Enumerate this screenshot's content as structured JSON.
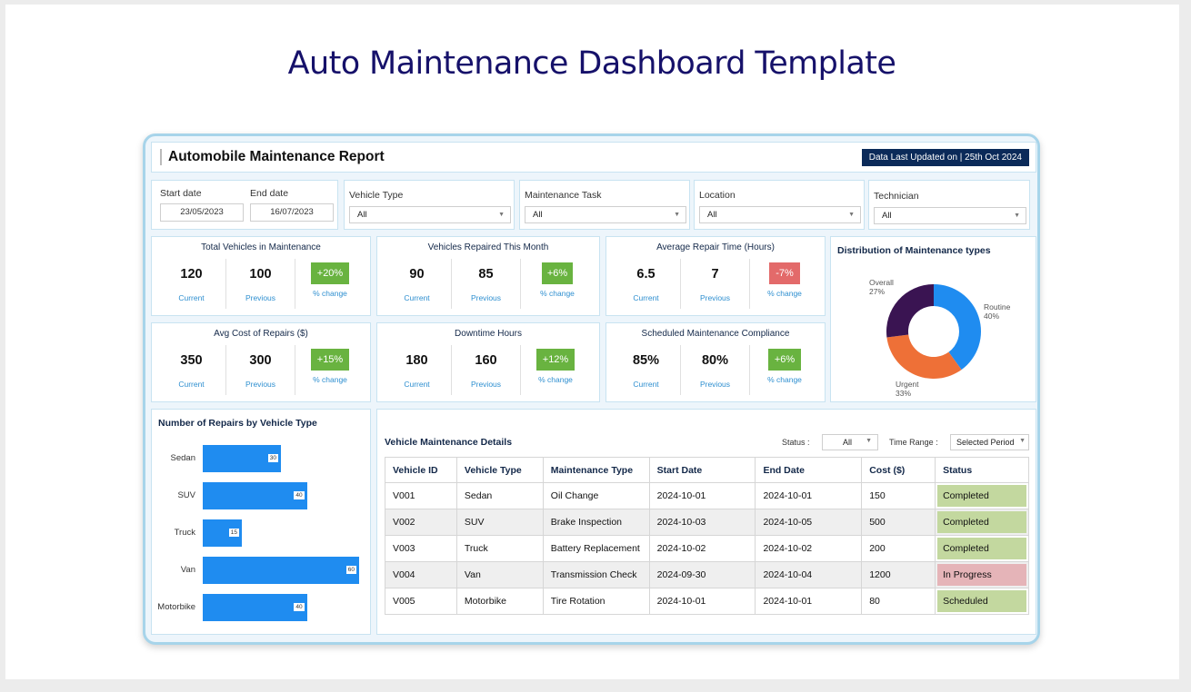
{
  "page_title": "Auto Maintenance Dashboard Template",
  "report": {
    "title": "Automobile Maintenance Report",
    "updated": "Data Last Updated on | 25th Oct 2024"
  },
  "filters": {
    "start_date_label": "Start date",
    "start_date": "23/05/2023",
    "end_date_label": "End date",
    "end_date": "16/07/2023",
    "vehicle_type_label": "Vehicle Type",
    "vehicle_type": "All",
    "maintenance_task_label": "Maintenance Task",
    "maintenance_task": "All",
    "location_label": "Location",
    "location": "All",
    "technician_label": "Technician",
    "technician": "All"
  },
  "kpis": [
    {
      "title": "Total Vehicles in Maintenance",
      "current": "120",
      "previous": "100",
      "change": "+20%",
      "positive": true
    },
    {
      "title": "Vehicles Repaired This Month",
      "current": "90",
      "previous": "85",
      "change": "+6%",
      "positive": true
    },
    {
      "title": "Average Repair Time (Hours)",
      "current": "6.5",
      "previous": "7",
      "change": "-7%",
      "positive": false
    },
    {
      "title": "Avg Cost of Repairs ($)",
      "current": "350",
      "previous": "300",
      "change": "+15%",
      "positive": true
    },
    {
      "title": "Downtime Hours",
      "current": "180",
      "previous": "160",
      "change": "+12%",
      "positive": true
    },
    {
      "title": "Scheduled Maintenance Compliance",
      "current": "85%",
      "previous": "80%",
      "change": "+6%",
      "positive": true
    }
  ],
  "kpi_labels": {
    "current": "Current",
    "previous": "Previous",
    "change": "% change"
  },
  "donut": {
    "title": "Distribution of Maintenance types",
    "slices": [
      {
        "name": "Routine",
        "pct": "40%",
        "value": 40,
        "color": "#1f8cf0"
      },
      {
        "name": "Urgent",
        "pct": "33%",
        "value": 33,
        "color": "#ee7037"
      },
      {
        "name": "Overall",
        "pct": "27%",
        "value": 27,
        "color": "#3a1452"
      }
    ]
  },
  "chart_data": {
    "type": "bar",
    "title": "Number of Repairs by Vehicle Type",
    "categories": [
      "Sedan",
      "SUV",
      "Truck",
      "Van",
      "Motorbike"
    ],
    "values": [
      30,
      40,
      15,
      60,
      40
    ],
    "xlim": [
      0,
      60
    ],
    "color": "#1f8cf0",
    "orientation": "horizontal"
  },
  "table": {
    "title": "Vehicle Maintenance Details",
    "status_label": "Status :",
    "status_value": "All",
    "time_label": "Time Range :",
    "time_value": "Selected Period",
    "columns": [
      "Vehicle ID",
      "Vehicle Type",
      "Maintenance Type",
      "Start Date",
      "End Date",
      "Cost ($)",
      "Status"
    ],
    "rows": [
      {
        "id": "V001",
        "type": "Sedan",
        "mtype": "Oil Change",
        "start": "2024-10-01",
        "end": "2024-10-01",
        "cost": "150",
        "status": "Completed"
      },
      {
        "id": "V002",
        "type": "SUV",
        "mtype": "Brake Inspection",
        "start": "2024-10-03",
        "end": "2024-10-05",
        "cost": "500",
        "status": "Completed"
      },
      {
        "id": "V003",
        "type": "Truck",
        "mtype": "Battery Replacement",
        "start": "2024-10-02",
        "end": "2024-10-02",
        "cost": "200",
        "status": "Completed"
      },
      {
        "id": "V004",
        "type": "Van",
        "mtype": "Transmission Check",
        "start": "2024-09-30",
        "end": "2024-10-04",
        "cost": "1200",
        "status": "In Progress"
      },
      {
        "id": "V005",
        "type": "Motorbike",
        "mtype": "Tire Rotation",
        "start": "2024-10-01",
        "end": "2024-10-01",
        "cost": "80",
        "status": "Scheduled"
      }
    ]
  }
}
